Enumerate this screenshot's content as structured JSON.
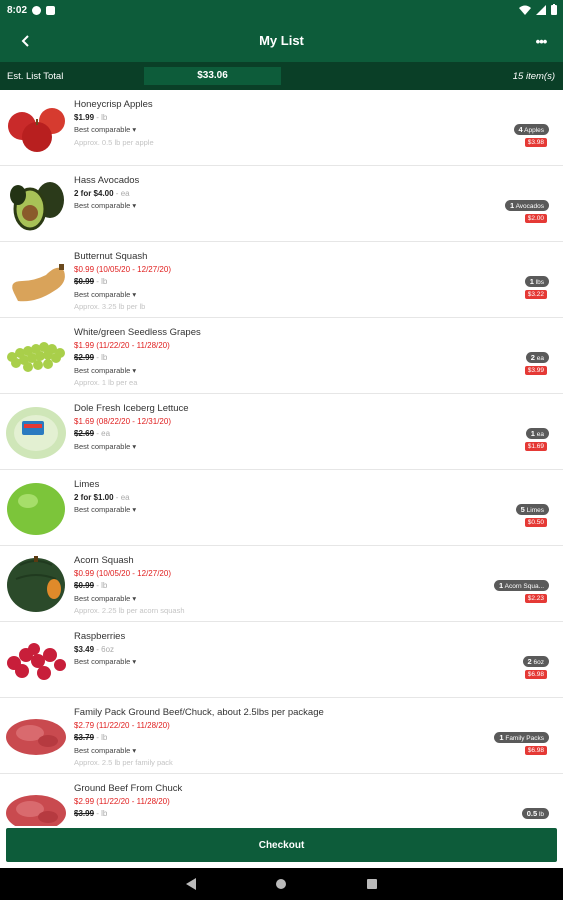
{
  "status_bar": {
    "time": "8:02"
  },
  "app_bar": {
    "title": "My List",
    "more_label": "•••"
  },
  "totals": {
    "label": "Est. List Total",
    "amount": "$33.06",
    "count": "15 item(s)"
  },
  "items": [
    {
      "name": "Honeycrisp Apples",
      "sale_price": "",
      "sale_dates": "",
      "price": "$1.99",
      "unit": " - lb",
      "comparable": "Best comparable ▾",
      "approx": "Approx. 0.5 lb per apple",
      "qty_num": "4",
      "qty_unit": "Apples",
      "line_total": "$3.98",
      "image": "apples"
    },
    {
      "name": "Hass Avocados",
      "sale_price": "",
      "sale_dates": "",
      "price": "2 for $4.00",
      "unit": " - ea",
      "comparable": "Best comparable ▾",
      "approx": "",
      "qty_num": "1",
      "qty_unit": "Avocados",
      "line_total": "$2.00",
      "image": "avocado"
    },
    {
      "name": "Butternut Squash",
      "sale_price": "$0.99",
      "sale_dates": "(10/05/20 - 12/27/20)",
      "price": "$0.99",
      "unit": " - lb",
      "comparable": "Best comparable ▾",
      "approx": "Approx. 3.25 lb per lb",
      "qty_num": "1",
      "qty_unit": "lbs",
      "line_total": "$3.22",
      "image": "butternut"
    },
    {
      "name": "White/green Seedless Grapes",
      "sale_price": "$1.99",
      "sale_dates": "(11/22/20 - 11/28/20)",
      "price": "$2.99",
      "unit": " - lb",
      "comparable": "Best comparable ▾",
      "approx": "Approx. 1 lb per ea",
      "qty_num": "2",
      "qty_unit": "ea",
      "line_total": "$3.99",
      "image": "grapes"
    },
    {
      "name": "Dole Fresh Iceberg Lettuce",
      "sale_price": "$1.69",
      "sale_dates": "(08/22/20 - 12/31/20)",
      "price": "$2.69",
      "unit": " - ea",
      "comparable": "Best comparable ▾",
      "approx": "",
      "qty_num": "1",
      "qty_unit": "ea",
      "line_total": "$1.69",
      "image": "lettuce"
    },
    {
      "name": "Limes",
      "sale_price": "",
      "sale_dates": "",
      "price": "2 for $1.00",
      "unit": " - ea",
      "comparable": "Best comparable ▾",
      "approx": "",
      "qty_num": "5",
      "qty_unit": "Limes",
      "line_total": "$0.50",
      "image": "lime"
    },
    {
      "name": "Acorn Squash",
      "sale_price": "$0.99",
      "sale_dates": "(10/05/20 - 12/27/20)",
      "price": "$0.99",
      "unit": " - lb",
      "comparable": "Best comparable ▾",
      "approx": "Approx. 2.25 lb per acorn squash",
      "qty_num": "1",
      "qty_unit": "Acorn Squa...",
      "line_total": "$2.23",
      "image": "acorn"
    },
    {
      "name": "Raspberries",
      "sale_price": "",
      "sale_dates": "",
      "price": "$3.49",
      "unit": " - 6oz",
      "comparable": "Best comparable ▾",
      "approx": "",
      "qty_num": "2",
      "qty_unit": "6oz",
      "line_total": "$6.98",
      "image": "raspberry"
    },
    {
      "name": "Family Pack Ground Beef/Chuck, about 2.5lbs per package",
      "sale_price": "$2.79",
      "sale_dates": "(11/22/20 - 11/28/20)",
      "price": "$3.79",
      "unit": " - lb",
      "comparable": "Best comparable ▾",
      "approx": "Approx. 2.5 lb per family pack",
      "qty_num": "1",
      "qty_unit": "Family Packs",
      "line_total": "$6.98",
      "image": "beef"
    },
    {
      "name": "Ground Beef From Chuck",
      "sale_price": "$2.99",
      "sale_dates": "(11/22/20 - 11/28/20)",
      "price": "$3.99",
      "unit": " - lb",
      "comparable": "",
      "approx": "",
      "qty_num": "0.5",
      "qty_unit": "lb",
      "line_total": "",
      "image": "beef"
    }
  ],
  "checkout": {
    "label": "Checkout"
  },
  "colors": {
    "primary": "#0d5c3a",
    "primary_dark": "#0a3f27",
    "sale": "#e02020",
    "badge": "#5a5a5a",
    "line_total": "#e53935"
  }
}
